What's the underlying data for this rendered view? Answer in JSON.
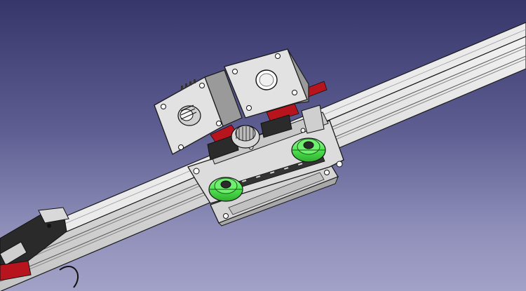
{
  "viewport": {
    "background_top": "#36366a",
    "background_bottom": "#a2a2c8",
    "model_fill": "#d6d6d6",
    "model_edge": "#1a1a1a",
    "wheel_color": "#4ee44e",
    "accent_color": "#b8141e"
  },
  "objects": [
    "aluminium-extrusion-rail",
    "carriage-plate",
    "stepper-motor-left",
    "stepper-motor-right",
    "gt2-pulley",
    "v-wheel-left",
    "v-wheel-right",
    "end-bracket"
  ]
}
